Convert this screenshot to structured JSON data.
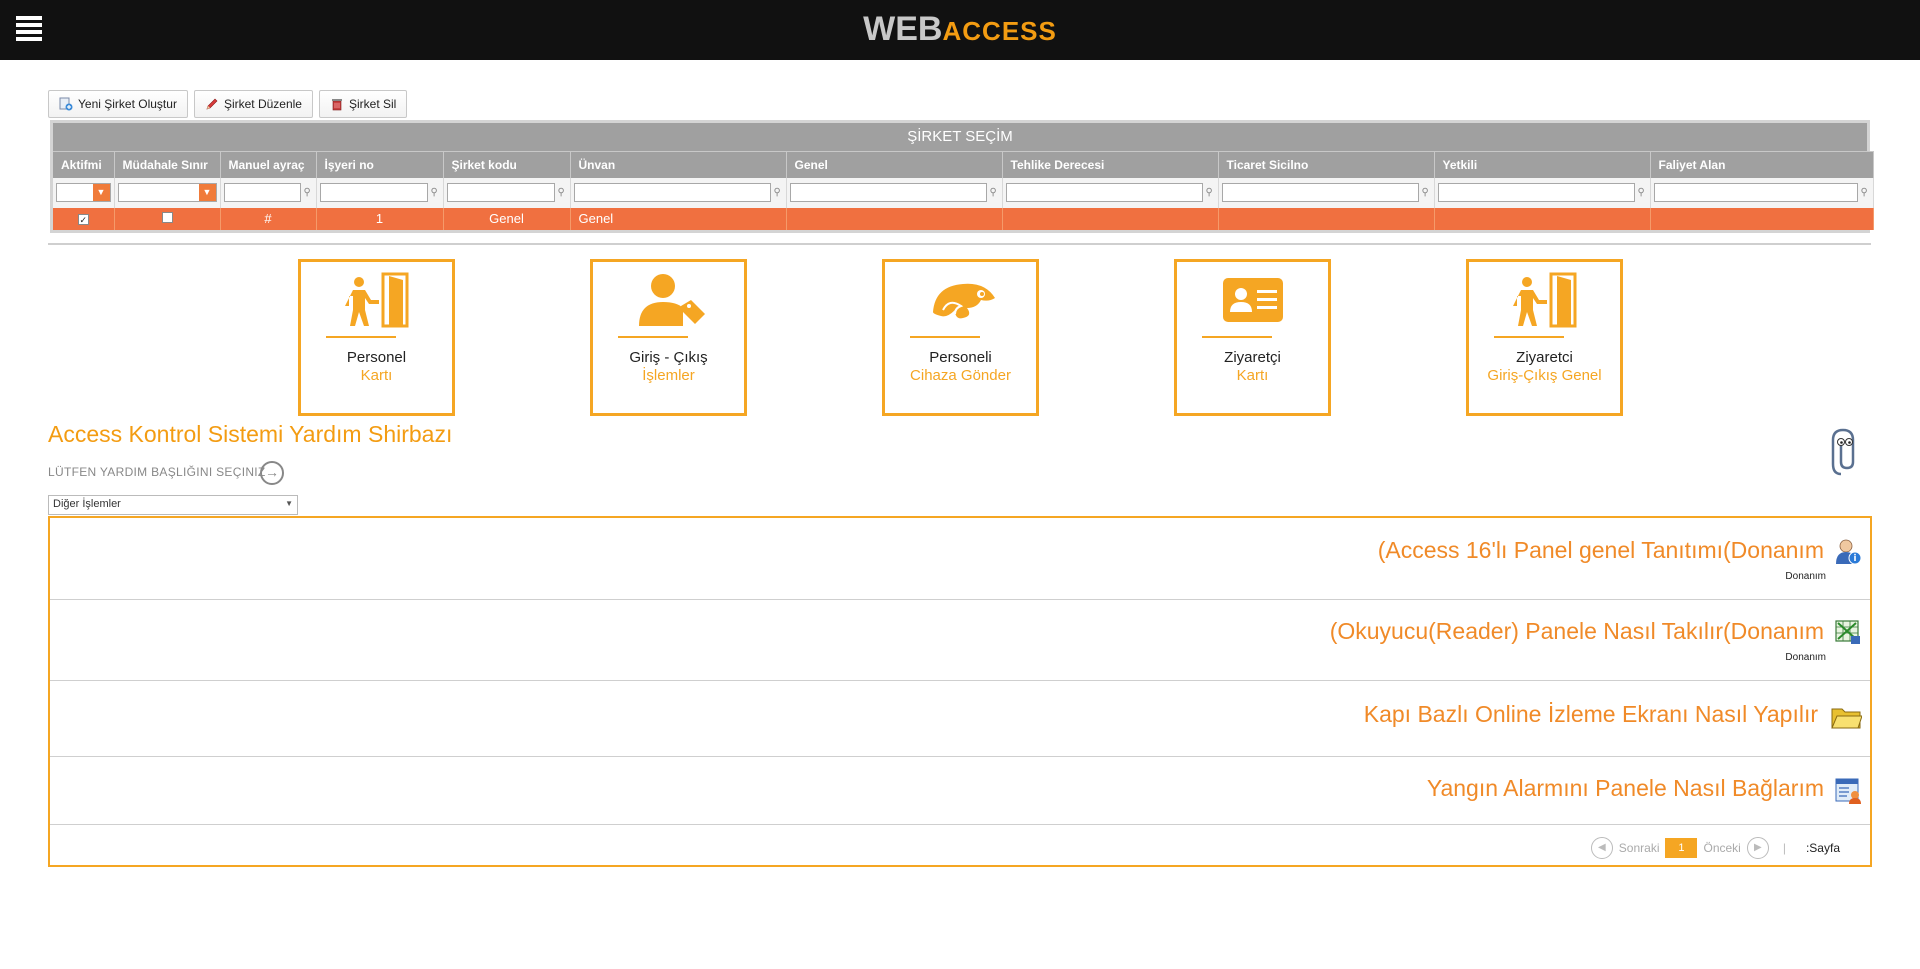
{
  "header": {
    "logo_web": "WEB",
    "logo_access": "ACCESS"
  },
  "toolbar": {
    "new_label": "Yeni Şirket Oluştur",
    "edit_label": "Şirket Düzenle",
    "delete_label": "Şirket Sil"
  },
  "grid": {
    "title": "ŞİRKET SEÇİM",
    "columns": [
      "Aktifmi",
      "Müdahale Sınır",
      "Manuel ayraç",
      "İşyeri no",
      "Şirket kodu",
      "Ünvan",
      "Genel",
      "Tehlike Derecesi",
      "Ticaret Sicilno",
      "Yetkili",
      "Faliyet Alan"
    ],
    "row": {
      "aktif": "✓",
      "manuel": "#",
      "isyeri": "1",
      "kod": "Genel",
      "unvan": "Genel"
    }
  },
  "tiles": [
    {
      "line1": "Personel",
      "line2": "Kartı",
      "icon": "door-person-icon"
    },
    {
      "line1": "Giriş - Çıkış",
      "line2": "İşlemler",
      "icon": "user-tag-icon"
    },
    {
      "line1": "Personeli",
      "line2": "Cihaza Gönder",
      "icon": "chameleon-icon"
    },
    {
      "line1": "Ziyaretçi",
      "line2": "Kartı",
      "icon": "id-card-icon"
    },
    {
      "line1": "Ziyaretci",
      "line2": "Giriş-Çıkış Genel",
      "icon": "door-person-icon"
    }
  ],
  "help": {
    "title": "Access Kontrol Sistemi Yardım Shirbazı",
    "subtitle": "LÜTFEN YARDIM BAŞLIĞINI SEÇINIZ",
    "select_value": "Diğer İşlemler",
    "items": [
      {
        "title": "(Access 16'lı Panel genel Tanıtımı(Donanım",
        "category": "Donanım",
        "icon": "user-info-icon"
      },
      {
        "title": "(Okuyucu(Reader) Panele Nasıl Takılır(Donanım",
        "category": "Donanım",
        "icon": "spreadsheet-icon"
      },
      {
        "title": "Kapı Bazlı Online İzleme Ekranı Nasıl Yapılır",
        "category": "",
        "icon": "folder-icon"
      },
      {
        "title": "Yangın Alarmını Panele Nasıl Bağlarım",
        "category": "",
        "icon": "user-card-icon"
      }
    ],
    "pager": {
      "next_label": "Sonraki",
      "current": "1",
      "prev_label": "Önceki",
      "separator": "|",
      "page_label": ":Sayfa"
    }
  },
  "colors": {
    "accent": "#f5a623",
    "row_highlight": "#f07040",
    "header_bg": "#111111"
  }
}
